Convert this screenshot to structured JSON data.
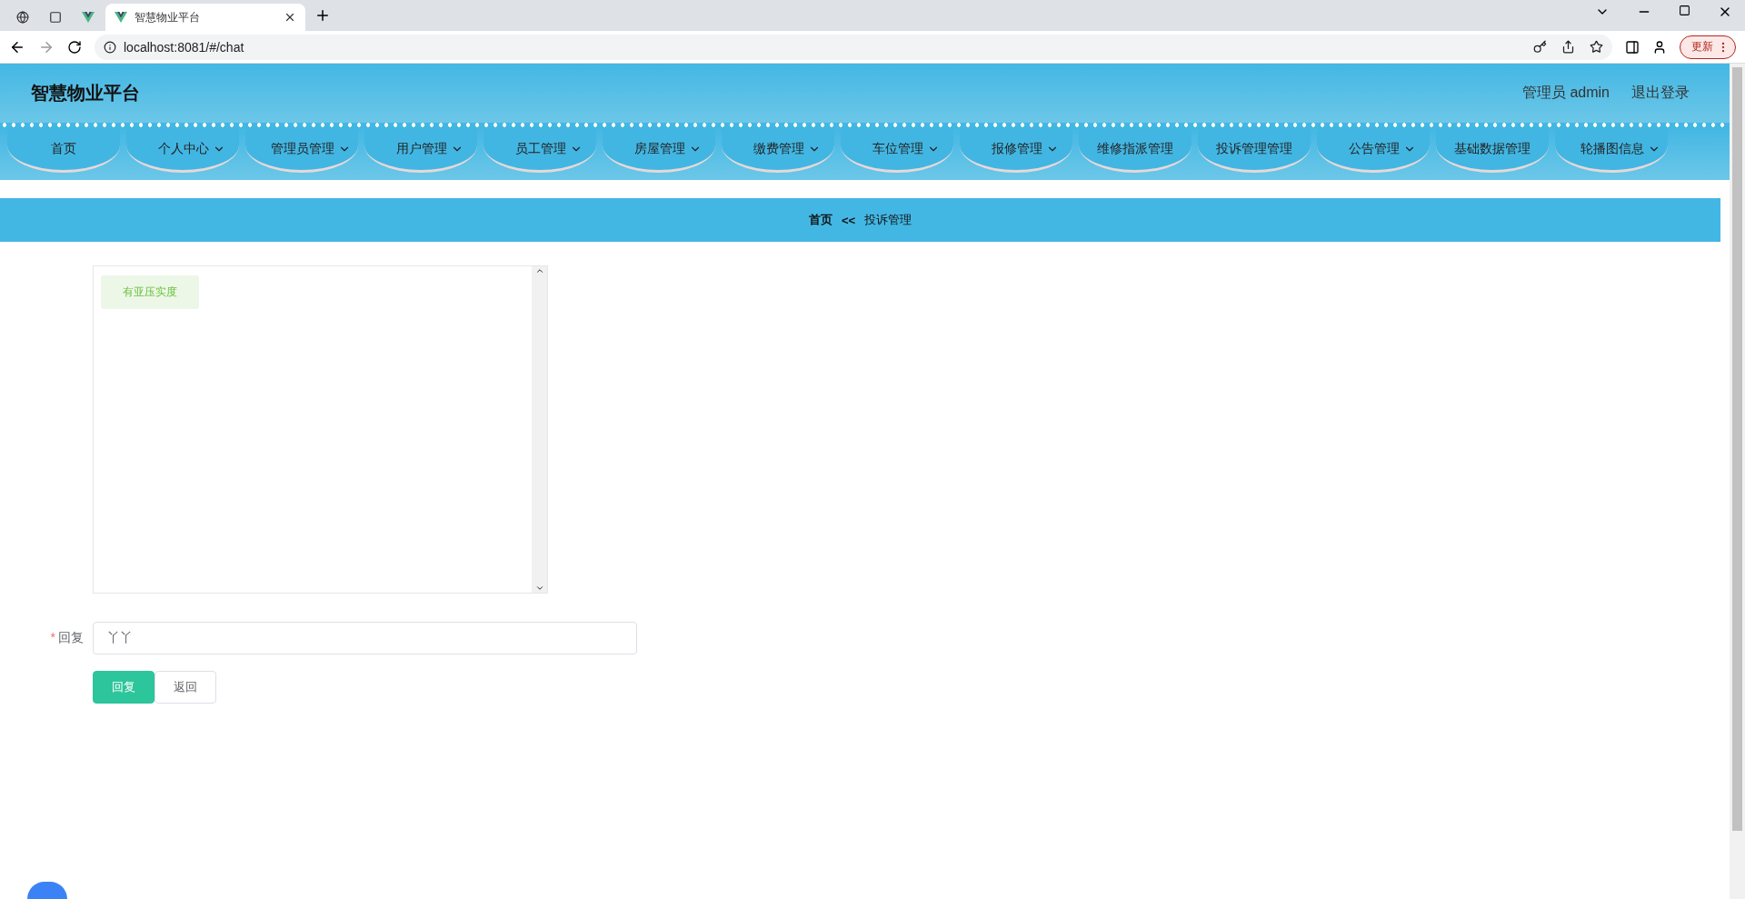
{
  "browser": {
    "tabs": [
      {
        "kind": "globe",
        "selected": false
      },
      {
        "kind": "blank",
        "selected": false
      },
      {
        "kind": "vue",
        "selected": false
      },
      {
        "kind": "vue",
        "title": "智慧物业平台",
        "selected": true
      }
    ],
    "url": "localhost:8081/#/chat",
    "update_button": "更新"
  },
  "header": {
    "title": "智慧物业平台",
    "user": "管理员 admin",
    "logout": "退出登录"
  },
  "nav": [
    {
      "label": "首页",
      "dropdown": false
    },
    {
      "label": "个人中心",
      "dropdown": true
    },
    {
      "label": "管理员管理",
      "dropdown": true
    },
    {
      "label": "用户管理",
      "dropdown": true
    },
    {
      "label": "员工管理",
      "dropdown": true
    },
    {
      "label": "房屋管理",
      "dropdown": true
    },
    {
      "label": "缴费管理",
      "dropdown": true
    },
    {
      "label": "车位管理",
      "dropdown": true
    },
    {
      "label": "报修管理",
      "dropdown": true
    },
    {
      "label": "维修指派管理",
      "dropdown": false
    },
    {
      "label": "投诉管理管理",
      "dropdown": false
    },
    {
      "label": "公告管理",
      "dropdown": true
    },
    {
      "label": "基础数据管理",
      "dropdown": false
    },
    {
      "label": "轮播图信息",
      "dropdown": true
    }
  ],
  "breadcrumb": {
    "home": "首页",
    "separator": "<<",
    "current": "投诉管理"
  },
  "chat": {
    "messages": [
      "有亚压实度"
    ]
  },
  "form": {
    "label": "回复",
    "required_mark": "*",
    "value": "丫丫"
  },
  "buttons": [
    {
      "label": "回复",
      "kind": "primary"
    },
    {
      "label": "返回",
      "kind": "default"
    }
  ]
}
